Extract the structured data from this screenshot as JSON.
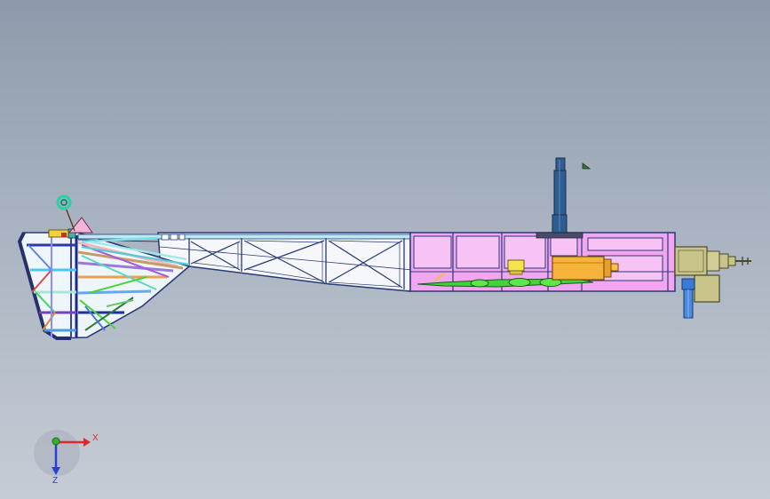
{
  "viewport": {
    "background_top": "#8e9aab",
    "background_bottom": "#c6ccd5"
  },
  "model": {
    "colors": {
      "tail_frame_fill": "#eef6fb",
      "fuselage_fill": "#f6f7fa",
      "section_fill": "#f2a6f0",
      "hub_yellow": "#f4e44d",
      "block_orange": "#f6b33a",
      "mast_blue": "#2f5d92",
      "gearbox_olive": "#c9c48a",
      "green_part": "#42d33a",
      "cyan_ring": "#24d4a5"
    }
  },
  "triad": {
    "x_label": "X",
    "z_label": "Z",
    "x_color": "#e2262c",
    "y_color": "#2fb32f",
    "z_color": "#2b3fd8"
  }
}
